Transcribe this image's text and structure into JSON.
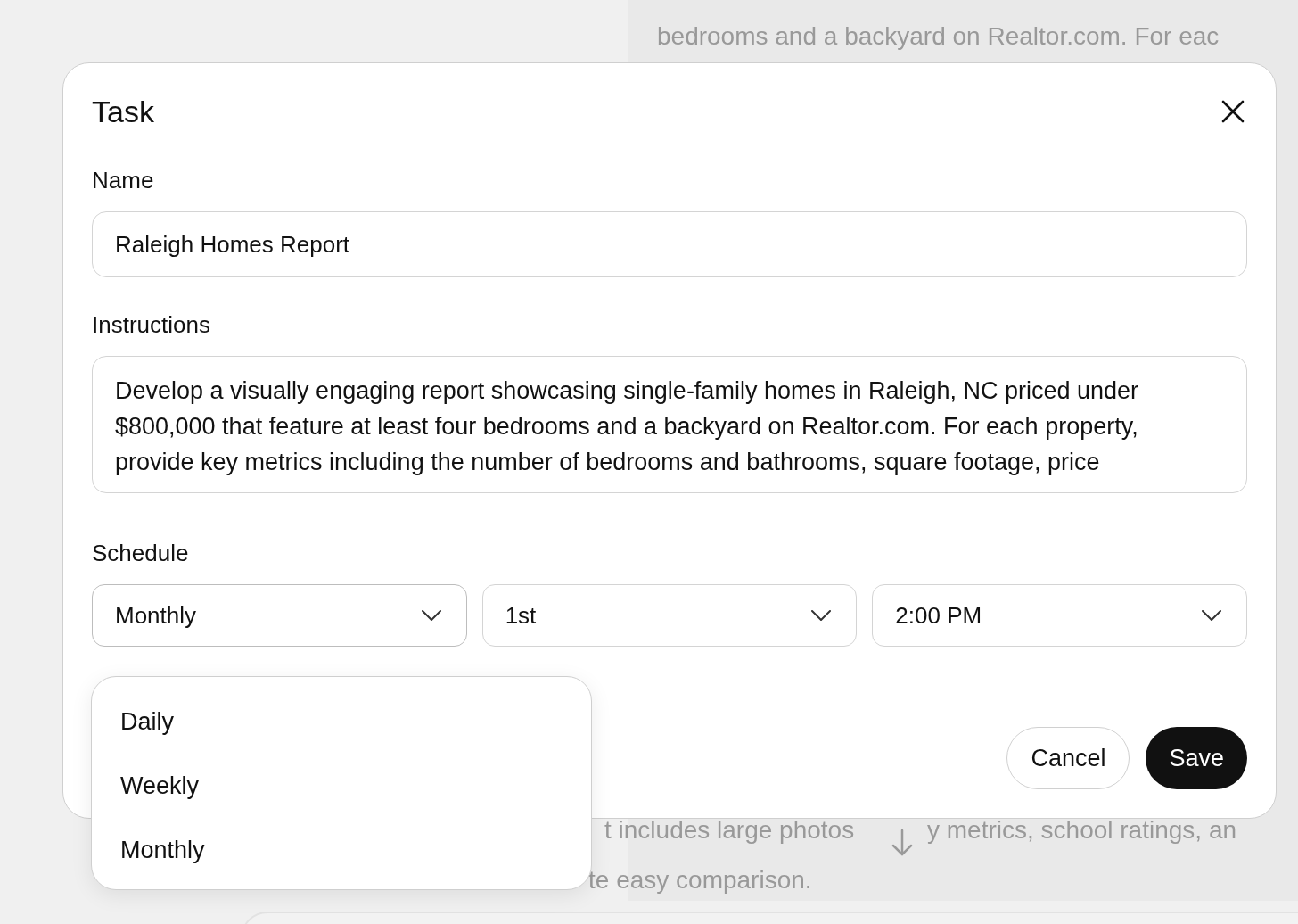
{
  "background": {
    "top_text": "bedrooms and a backyard on Realtor.com. For eac",
    "bottom_texts": [
      "t includes large photos",
      "y metrics, school ratings, an"
    ],
    "last_text": "te easy comparison."
  },
  "dialog": {
    "title": "Task",
    "fields": [
      {
        "label": "Name",
        "kind": "input",
        "value": "Raleigh Homes Report"
      },
      {
        "label": "Instructions",
        "kind": "textarea",
        "value": "Develop a visually engaging report showcasing single-family homes in Raleigh, NC priced under $800,000 that feature at least four bedrooms and a backyard on Realtor.com. For each property, provide key metrics including the number of bedrooms and bathrooms, square footage, price"
      }
    ],
    "schedule": {
      "label": "Schedule",
      "selects": [
        {
          "value": "Monthly",
          "expanded": true
        },
        {
          "value": "1st",
          "expanded": false
        },
        {
          "value": "2:00 PM",
          "expanded": false
        }
      ]
    },
    "buttons": [
      {
        "label": "Cancel",
        "kind": "secondary"
      },
      {
        "label": "Save",
        "kind": "primary"
      }
    ]
  },
  "dropdown": {
    "options": [
      {
        "label": "Daily"
      },
      {
        "label": "Weekly"
      },
      {
        "label": "Monthly"
      }
    ]
  }
}
